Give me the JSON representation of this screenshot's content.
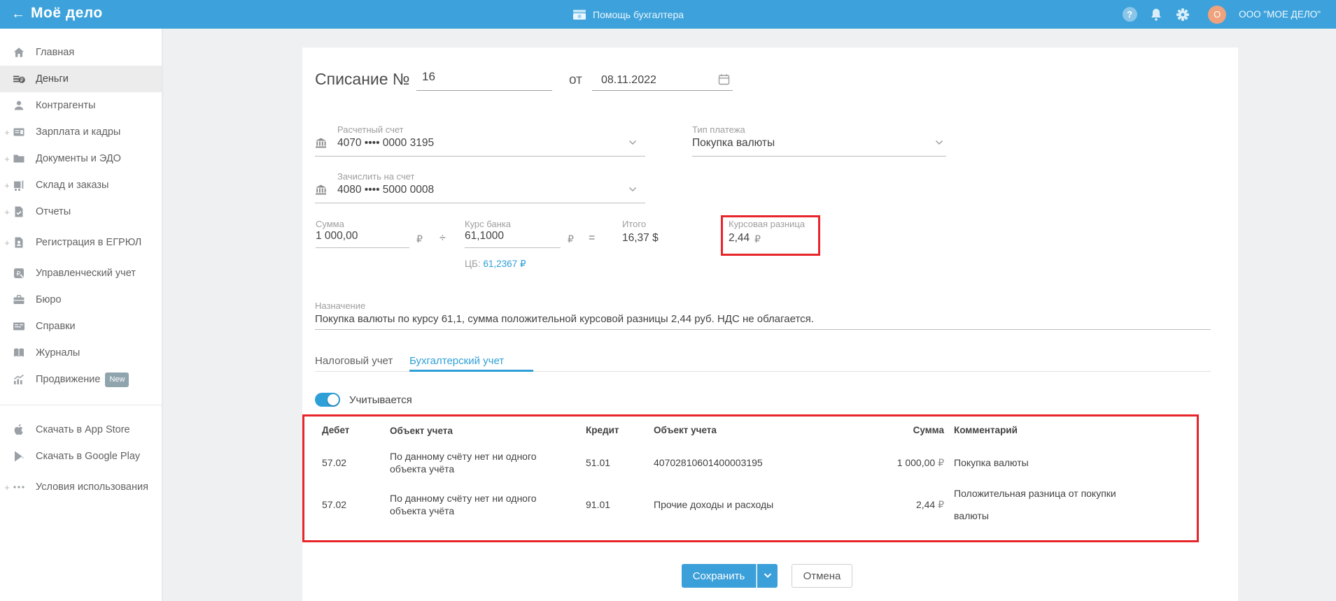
{
  "header": {
    "logo": "Моё дело",
    "helper_link": "Помощь бухгалтера",
    "company": "ООО \"МОЕ ДЕЛО\"",
    "avatar_letter": "O",
    "help_glyph": "?"
  },
  "sidebar": {
    "items": [
      {
        "label": "Главная",
        "plus": ""
      },
      {
        "label": "Деньги",
        "plus": ""
      },
      {
        "label": "Контрагенты",
        "plus": ""
      },
      {
        "label": "Зарплата и кадры",
        "plus": "+"
      },
      {
        "label": "Документы и ЭДО",
        "plus": "+"
      },
      {
        "label": "Склад и заказы",
        "plus": "+"
      },
      {
        "label": "Отчеты",
        "plus": "+"
      },
      {
        "label": "Регистрация в ЕГРЮЛ",
        "plus": "+"
      },
      {
        "label": "Управленческий учет",
        "plus": ""
      },
      {
        "label": "Бюро",
        "plus": ""
      },
      {
        "label": "Справки",
        "plus": ""
      },
      {
        "label": "Журналы",
        "plus": ""
      },
      {
        "label": "Продвижение",
        "plus": "",
        "badge": "New"
      }
    ],
    "footer_items": [
      {
        "label": "Скачать в App Store",
        "plus": ""
      },
      {
        "label": "Скачать в Google Play",
        "plus": ""
      },
      {
        "label": "Условия использования",
        "plus": "+"
      }
    ]
  },
  "form": {
    "title": "Списание №",
    "number": "16",
    "date_preposition": "от",
    "date": "08.11.2022",
    "debit_account": {
      "label": "Расчетный счет",
      "value": "4070 •••• 0000 3195"
    },
    "payment_type": {
      "label": "Тип платежа",
      "value": "Покупка валюты"
    },
    "credit_account": {
      "label": "Зачислить на счет",
      "value": "4080 •••• 5000 0008"
    },
    "amount": {
      "label": "Сумма",
      "value": "1 000,00",
      "currency": "₽"
    },
    "divide_sign": "÷",
    "bank_rate": {
      "label": "Курс банка",
      "value": "61,1000",
      "currency": "₽"
    },
    "equals_sign": "=",
    "total": {
      "label": "Итого",
      "value": "16,37 $"
    },
    "rate_difference": {
      "label": "Курсовая разница",
      "value": "2,44",
      "currency": "₽"
    },
    "cb_rate": {
      "prefix": "ЦБ:",
      "value": "61,2367",
      "currency": "₽"
    },
    "purpose": {
      "label": "Назначение",
      "value": "Покупка валюты по курсу 61,1, сумма положительной курсовой разницы 2,44 руб. НДС не облагается."
    }
  },
  "tabs": [
    {
      "label": "Налоговый учет"
    },
    {
      "label": "Бухгалтерский учет"
    }
  ],
  "toggle_label": "Учитывается",
  "table": {
    "headers": [
      "Дебет",
      "Объект учета",
      "Кредит",
      "Объект учета",
      "Сумма",
      "Комментарий"
    ],
    "rows": [
      {
        "debit": "57.02",
        "object1": "По данному счёту нет ни одного объекта учёта",
        "credit": "51.01",
        "object2": "40702810601400003195",
        "sum": "1 000,00",
        "currency": "₽",
        "comment": "Покупка валюты"
      },
      {
        "debit": "57.02",
        "object1": "По данному счёту нет ни одного объекта учёта",
        "credit": "91.01",
        "object2": "Прочие доходы и расходы",
        "sum": "2,44",
        "currency": "₽",
        "comment": "Положительная разница от покупки валюты"
      }
    ]
  },
  "buttons": {
    "save": "Сохранить",
    "cancel": "Отмена"
  },
  "colors": {
    "header_blue": "#3da2db",
    "accent_blue": "#2f9fd8",
    "highlight_red": "#e8252a",
    "avatar_orange": "#f0a27d",
    "badge_gray": "#90a4ae"
  }
}
